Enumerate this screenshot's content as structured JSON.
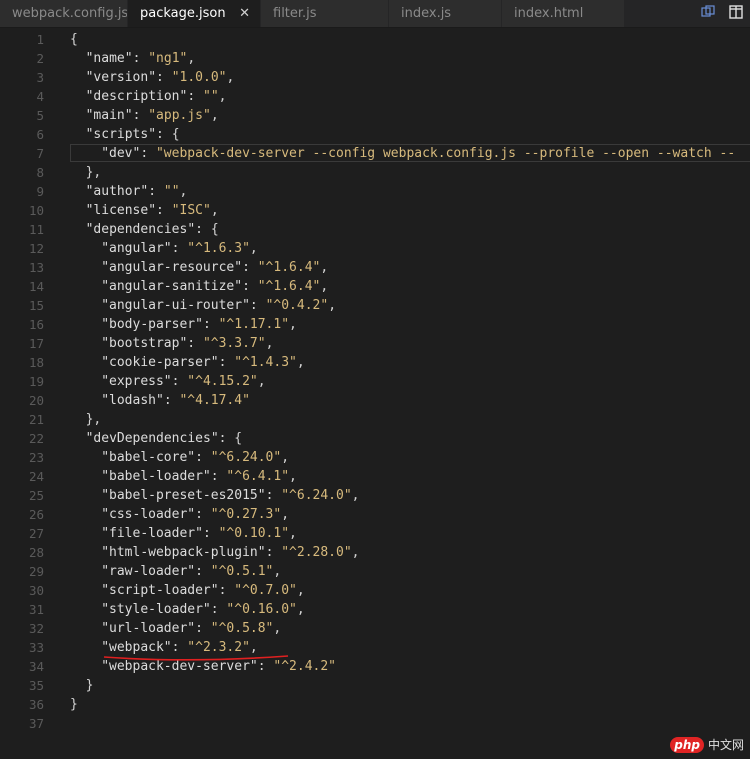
{
  "tabs": [
    {
      "label": "webpack.config.js",
      "active": false
    },
    {
      "label": "package.json",
      "active": true
    },
    {
      "label": "filter.js",
      "active": false
    },
    {
      "label": "index.js",
      "active": false
    },
    {
      "label": "index.html",
      "active": false
    }
  ],
  "tab_close_glyph": "✕",
  "tab_actions": [
    {
      "icon": "split-view-icon"
    },
    {
      "icon": "layout-icon"
    }
  ],
  "lines": [
    {
      "n": "1",
      "indent": 0,
      "parts": [
        [
          "p",
          "{"
        ]
      ]
    },
    {
      "n": "2",
      "indent": 1,
      "parts": [
        [
          "k",
          "\"name\""
        ],
        [
          "p",
          ": "
        ],
        [
          "s",
          "\"ng1\""
        ],
        [
          "p",
          ","
        ]
      ]
    },
    {
      "n": "3",
      "indent": 1,
      "parts": [
        [
          "k",
          "\"version\""
        ],
        [
          "p",
          ": "
        ],
        [
          "s",
          "\"1.0.0\""
        ],
        [
          "p",
          ","
        ]
      ]
    },
    {
      "n": "4",
      "indent": 1,
      "parts": [
        [
          "k",
          "\"description\""
        ],
        [
          "p",
          ": "
        ],
        [
          "s",
          "\"\""
        ],
        [
          "p",
          ","
        ]
      ]
    },
    {
      "n": "5",
      "indent": 1,
      "parts": [
        [
          "k",
          "\"main\""
        ],
        [
          "p",
          ": "
        ],
        [
          "s",
          "\"app.js\""
        ],
        [
          "p",
          ","
        ]
      ]
    },
    {
      "n": "6",
      "indent": 1,
      "parts": [
        [
          "k",
          "\"scripts\""
        ],
        [
          "p",
          ": {"
        ]
      ]
    },
    {
      "n": "7",
      "indent": 2,
      "parts": [
        [
          "k",
          "\"dev\""
        ],
        [
          "p",
          ": "
        ],
        [
          "s",
          "\"webpack-dev-server --config webpack.config.js --profile --open --watch --"
        ]
      ]
    },
    {
      "n": "8",
      "indent": 1,
      "parts": [
        [
          "p",
          "},"
        ]
      ]
    },
    {
      "n": "9",
      "indent": 1,
      "parts": [
        [
          "k",
          "\"author\""
        ],
        [
          "p",
          ": "
        ],
        [
          "s",
          "\"\""
        ],
        [
          "p",
          ","
        ]
      ]
    },
    {
      "n": "10",
      "indent": 1,
      "parts": [
        [
          "k",
          "\"license\""
        ],
        [
          "p",
          ": "
        ],
        [
          "s",
          "\"ISC\""
        ],
        [
          "p",
          ","
        ]
      ]
    },
    {
      "n": "11",
      "indent": 1,
      "parts": [
        [
          "k",
          "\"dependencies\""
        ],
        [
          "p",
          ": {"
        ]
      ]
    },
    {
      "n": "12",
      "indent": 2,
      "parts": [
        [
          "k",
          "\"angular\""
        ],
        [
          "p",
          ": "
        ],
        [
          "s",
          "\"^1.6.3\""
        ],
        [
          "p",
          ","
        ]
      ]
    },
    {
      "n": "13",
      "indent": 2,
      "parts": [
        [
          "k",
          "\"angular-resource\""
        ],
        [
          "p",
          ": "
        ],
        [
          "s",
          "\"^1.6.4\""
        ],
        [
          "p",
          ","
        ]
      ]
    },
    {
      "n": "14",
      "indent": 2,
      "parts": [
        [
          "k",
          "\"angular-sanitize\""
        ],
        [
          "p",
          ": "
        ],
        [
          "s",
          "\"^1.6.4\""
        ],
        [
          "p",
          ","
        ]
      ]
    },
    {
      "n": "15",
      "indent": 2,
      "parts": [
        [
          "k",
          "\"angular-ui-router\""
        ],
        [
          "p",
          ": "
        ],
        [
          "s",
          "\"^0.4.2\""
        ],
        [
          "p",
          ","
        ]
      ]
    },
    {
      "n": "16",
      "indent": 2,
      "parts": [
        [
          "k",
          "\"body-parser\""
        ],
        [
          "p",
          ": "
        ],
        [
          "s",
          "\"^1.17.1\""
        ],
        [
          "p",
          ","
        ]
      ]
    },
    {
      "n": "17",
      "indent": 2,
      "parts": [
        [
          "k",
          "\"bootstrap\""
        ],
        [
          "p",
          ": "
        ],
        [
          "s",
          "\"^3.3.7\""
        ],
        [
          "p",
          ","
        ]
      ]
    },
    {
      "n": "18",
      "indent": 2,
      "parts": [
        [
          "k",
          "\"cookie-parser\""
        ],
        [
          "p",
          ": "
        ],
        [
          "s",
          "\"^1.4.3\""
        ],
        [
          "p",
          ","
        ]
      ]
    },
    {
      "n": "19",
      "indent": 2,
      "parts": [
        [
          "k",
          "\"express\""
        ],
        [
          "p",
          ": "
        ],
        [
          "s",
          "\"^4.15.2\""
        ],
        [
          "p",
          ","
        ]
      ]
    },
    {
      "n": "20",
      "indent": 2,
      "parts": [
        [
          "k",
          "\"lodash\""
        ],
        [
          "p",
          ": "
        ],
        [
          "s",
          "\"^4.17.4\""
        ]
      ]
    },
    {
      "n": "21",
      "indent": 1,
      "parts": [
        [
          "p",
          "},"
        ]
      ]
    },
    {
      "n": "22",
      "indent": 1,
      "parts": [
        [
          "k",
          "\"devDependencies\""
        ],
        [
          "p",
          ": {"
        ]
      ]
    },
    {
      "n": "23",
      "indent": 2,
      "parts": [
        [
          "k",
          "\"babel-core\""
        ],
        [
          "p",
          ": "
        ],
        [
          "s",
          "\"^6.24.0\""
        ],
        [
          "p",
          ","
        ]
      ]
    },
    {
      "n": "24",
      "indent": 2,
      "parts": [
        [
          "k",
          "\"babel-loader\""
        ],
        [
          "p",
          ": "
        ],
        [
          "s",
          "\"^6.4.1\""
        ],
        [
          "p",
          ","
        ]
      ]
    },
    {
      "n": "25",
      "indent": 2,
      "parts": [
        [
          "k",
          "\"babel-preset-es2015\""
        ],
        [
          "p",
          ": "
        ],
        [
          "s",
          "\"^6.24.0\""
        ],
        [
          "p",
          ","
        ]
      ]
    },
    {
      "n": "26",
      "indent": 2,
      "parts": [
        [
          "k",
          "\"css-loader\""
        ],
        [
          "p",
          ": "
        ],
        [
          "s",
          "\"^0.27.3\""
        ],
        [
          "p",
          ","
        ]
      ]
    },
    {
      "n": "27",
      "indent": 2,
      "parts": [
        [
          "k",
          "\"file-loader\""
        ],
        [
          "p",
          ": "
        ],
        [
          "s",
          "\"^0.10.1\""
        ],
        [
          "p",
          ","
        ]
      ]
    },
    {
      "n": "28",
      "indent": 2,
      "parts": [
        [
          "k",
          "\"html-webpack-plugin\""
        ],
        [
          "p",
          ": "
        ],
        [
          "s",
          "\"^2.28.0\""
        ],
        [
          "p",
          ","
        ]
      ]
    },
    {
      "n": "29",
      "indent": 2,
      "parts": [
        [
          "k",
          "\"raw-loader\""
        ],
        [
          "p",
          ": "
        ],
        [
          "s",
          "\"^0.5.1\""
        ],
        [
          "p",
          ","
        ]
      ]
    },
    {
      "n": "30",
      "indent": 2,
      "parts": [
        [
          "k",
          "\"script-loader\""
        ],
        [
          "p",
          ": "
        ],
        [
          "s",
          "\"^0.7.0\""
        ],
        [
          "p",
          ","
        ]
      ]
    },
    {
      "n": "31",
      "indent": 2,
      "parts": [
        [
          "k",
          "\"style-loader\""
        ],
        [
          "p",
          ": "
        ],
        [
          "s",
          "\"^0.16.0\""
        ],
        [
          "p",
          ","
        ]
      ]
    },
    {
      "n": "32",
      "indent": 2,
      "parts": [
        [
          "k",
          "\"url-loader\""
        ],
        [
          "p",
          ": "
        ],
        [
          "s",
          "\"^0.5.8\""
        ],
        [
          "p",
          ","
        ]
      ]
    },
    {
      "n": "33",
      "indent": 2,
      "parts": [
        [
          "k",
          "\"webpack\""
        ],
        [
          "p",
          ": "
        ],
        [
          "s",
          "\"^2.3.2\""
        ],
        [
          "p",
          ","
        ]
      ]
    },
    {
      "n": "34",
      "indent": 2,
      "parts": [
        [
          "k",
          "\"webpack-dev-server\""
        ],
        [
          "p",
          ": "
        ],
        [
          "s",
          "\"^2.4.2\""
        ]
      ]
    },
    {
      "n": "35",
      "indent": 1,
      "parts": [
        [
          "p",
          "}"
        ]
      ]
    },
    {
      "n": "36",
      "indent": 0,
      "parts": [
        [
          "p",
          "}"
        ]
      ]
    },
    {
      "n": "37",
      "indent": 0,
      "parts": []
    }
  ],
  "current_line": "7",
  "annotation": {
    "color": "#e02020",
    "line": "33"
  },
  "watermark": {
    "logo": "php",
    "text": "中文网"
  },
  "colors": {
    "background": "#1e1e1e",
    "string": "#d7ba7d",
    "key": "#dcdcdc",
    "line_number": "#5a5a5a"
  }
}
